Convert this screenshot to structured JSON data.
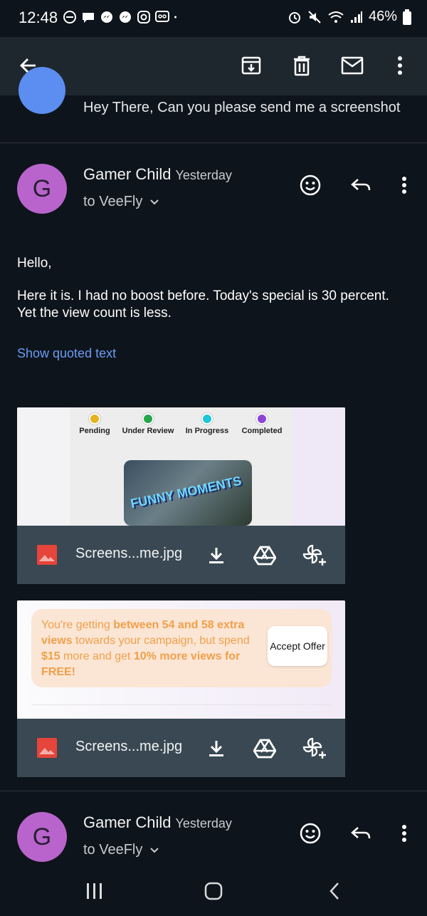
{
  "status_bar": {
    "time": "12:48",
    "battery": "46%",
    "left_icons": [
      "dnd-icon",
      "chat-bubble-icon",
      "messenger-icon",
      "messenger-icon",
      "instagram-icon",
      "voicemail-icon",
      "dot-icon"
    ],
    "right_icons": [
      "alarm-icon",
      "mute-icon",
      "wifi-icon",
      "signal-icon",
      "battery-icon"
    ]
  },
  "toolbar": {
    "back_icon": "arrow-back-icon",
    "actions": [
      "archive-icon",
      "delete-icon",
      "mark-unread-icon",
      "more-vert-icon"
    ]
  },
  "prior_message": {
    "snippet": "Hey There, Can you please send me a screenshot"
  },
  "message": {
    "avatar_letter": "G",
    "sender": "Gamer Child",
    "time": "Yesterday",
    "recipient": "to VeeFly",
    "greeting": "Hello,",
    "body_line1": "Here it is. I had no boost before. Today's special is 30 percent.",
    "body_line2": "Yet the view count is less.",
    "show_quoted": "Show quoted text"
  },
  "attachments": [
    {
      "filename": "Screens...me.jpg",
      "steps": [
        {
          "label": "Pending",
          "color": "#e6b21f"
        },
        {
          "label": "Under Review",
          "color": "#22a84a"
        },
        {
          "label": "In Progress",
          "color": "#1cc6d8"
        },
        {
          "label": "Completed",
          "color": "#8e44d6"
        }
      ],
      "thumb_text": "FUNNY MOMENTS"
    },
    {
      "filename": "Screens...me.jpg",
      "offer": {
        "t1": "You're getting ",
        "t2": "between 54 and 58 extra views",
        "t3": " towards your campaign, but spend ",
        "t4": "$15",
        "t5": " more and get ",
        "t6": "10% more views for FREE!",
        "button": "Accept Offer"
      }
    }
  ],
  "message2": {
    "avatar_letter": "G",
    "sender": "Gamer Child",
    "time": "Yesterday",
    "recipient": "to VeeFly"
  },
  "nav": [
    "recents-icon",
    "home-icon",
    "back-icon"
  ],
  "colors": {
    "accent_link": "#6b9bf2",
    "avatar": "#b864cc",
    "app_bar": "#1f272e"
  }
}
